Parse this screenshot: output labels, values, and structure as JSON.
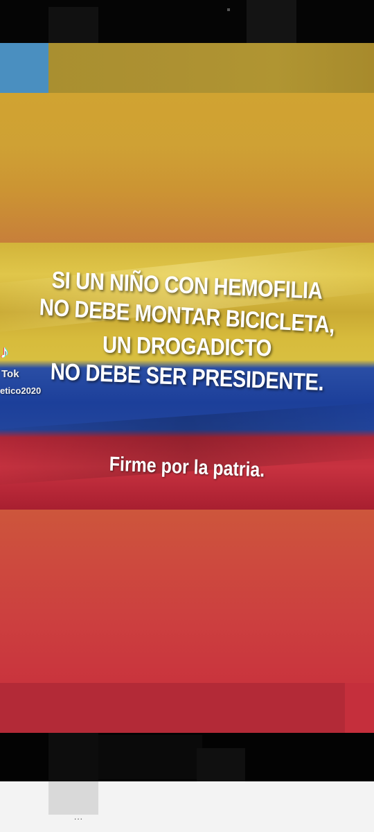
{
  "post": {
    "headline_lines": [
      "SI UN NIÑO CON HEMOFILIA",
      "NO DEBE MONTAR BICICLETA,",
      "UN DROGADICTO",
      "NO DEBE SER PRESIDENTE."
    ],
    "tagline": "Firme por la patria."
  },
  "watermark": {
    "icon": "tiktok-note-icon",
    "brand": "Tok",
    "username": "etico2020"
  },
  "nav": {
    "indicator": "..."
  },
  "colors": {
    "flag_yellow": "#d2b43a",
    "flag_blue": "#1c3f9a",
    "flag_red": "#c83240"
  }
}
